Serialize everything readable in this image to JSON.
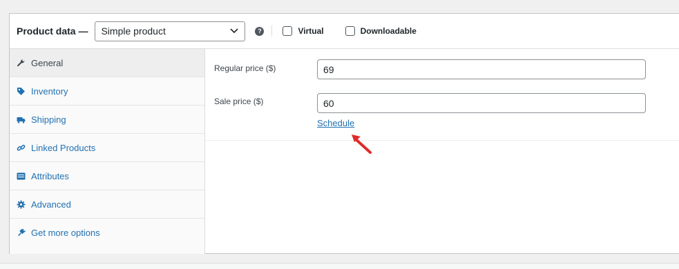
{
  "header": {
    "title": "Product data —",
    "product_type": {
      "selected": "Simple product"
    },
    "help_icon": "question-icon",
    "checkboxes": [
      {
        "label": "Virtual",
        "checked": false
      },
      {
        "label": "Downloadable",
        "checked": false
      }
    ]
  },
  "sidebar": {
    "items": [
      {
        "label": "General",
        "icon": "wrench-icon",
        "active": true
      },
      {
        "label": "Inventory",
        "icon": "tag-icon",
        "active": false
      },
      {
        "label": "Shipping",
        "icon": "truck-icon",
        "active": false
      },
      {
        "label": "Linked Products",
        "icon": "link-icon",
        "active": false
      },
      {
        "label": "Attributes",
        "icon": "list-icon",
        "active": false
      },
      {
        "label": "Advanced",
        "icon": "gear-icon",
        "active": false
      },
      {
        "label": "Get more options",
        "icon": "plug-icon",
        "active": false
      }
    ]
  },
  "general": {
    "regular_price": {
      "label": "Regular price ($)",
      "value": "69"
    },
    "sale_price": {
      "label": "Sale price ($)",
      "value": "60"
    },
    "schedule_link": "Schedule"
  },
  "colors": {
    "link": "#2271b1",
    "border": "#8c8f94",
    "annotation_arrow": "#e02a2a"
  }
}
